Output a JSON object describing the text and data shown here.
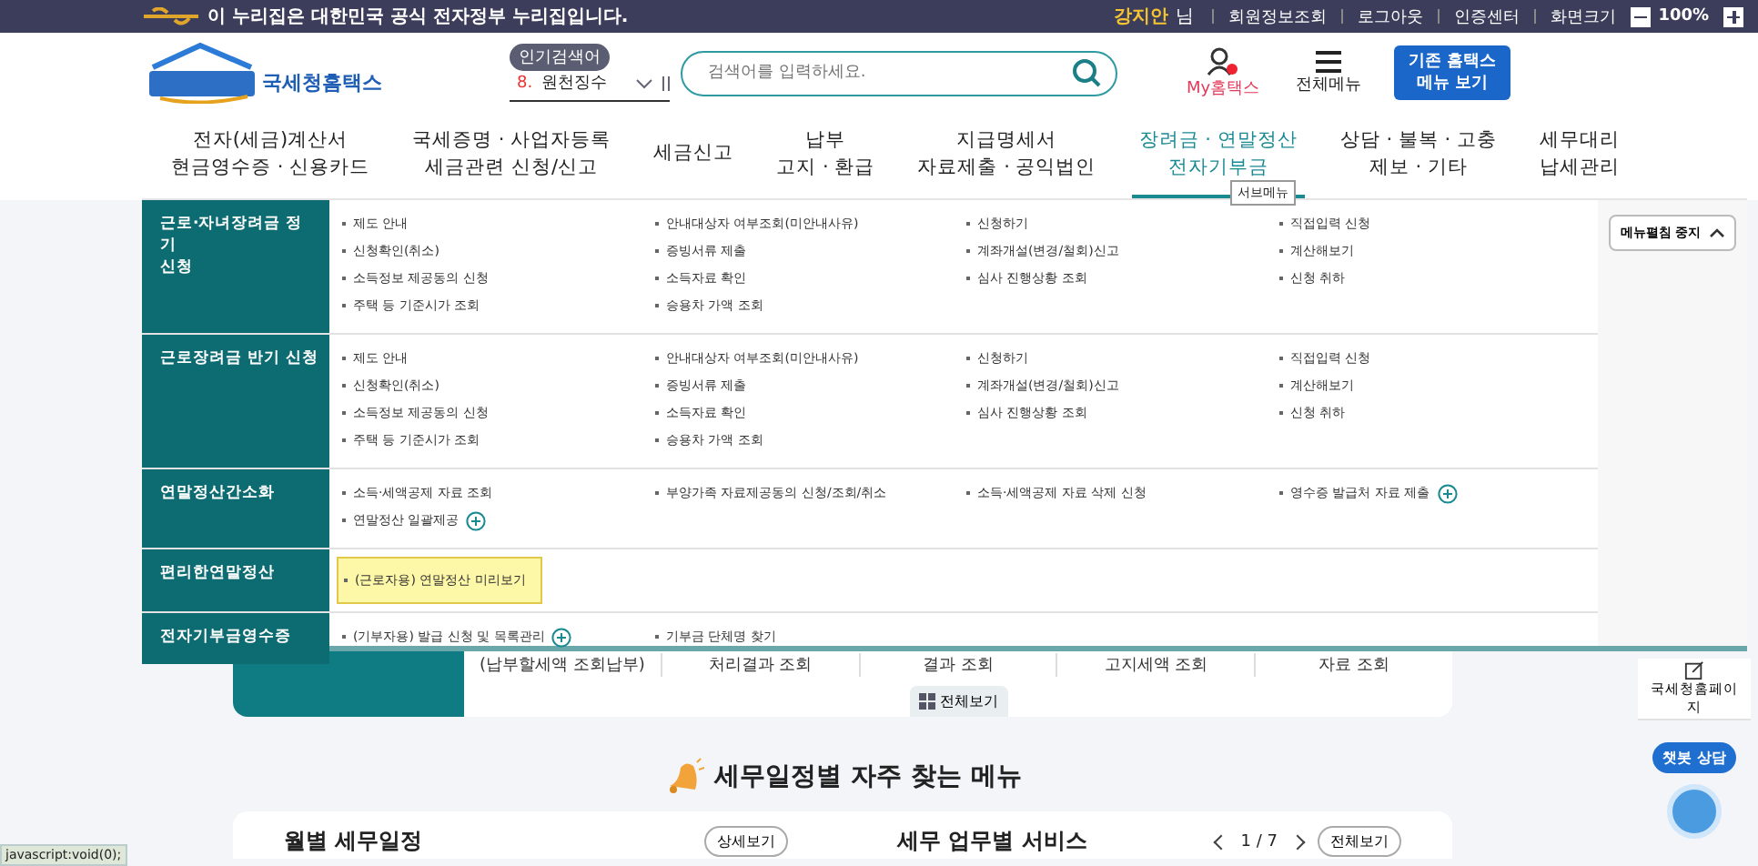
{
  "notice_bar": {
    "text": "이 누리집은 대한민국 공식 전자정부 누리집입니다.",
    "user_name": "강지안",
    "user_suffix": "님",
    "links": [
      "회원정보조회",
      "로그아웃",
      "인증센터",
      "화면크기"
    ],
    "zoom": "100%"
  },
  "header": {
    "logo_text": "국세청홈택스",
    "popular_badge": "인기검색어",
    "popular_rank": "8.",
    "popular_term": "원천징수",
    "search": {
      "placeholder": "검색어를 입력하세요."
    },
    "my_link": "My홈택스",
    "all_menu": "전체메뉴",
    "legacy_button": "기존 홈택스\n메뉴 보기"
  },
  "nav": [
    {
      "label": "전자(세금)계산서\n현금영수증 · 신용카드",
      "selected": false
    },
    {
      "label": "국세증명 · 사업자등록\n세금관련 신청/신고",
      "selected": false
    },
    {
      "label": "세금신고",
      "selected": false
    },
    {
      "label": "납부\n고지 · 환급",
      "selected": false
    },
    {
      "label": "지급명세서\n자료제출 · 공익법인",
      "selected": false
    },
    {
      "label": "장려금 · 연말정산\n전자기부금",
      "selected": true
    },
    {
      "label": "상담 · 불복 · 고충\n제보 · 기타",
      "selected": false
    },
    {
      "label": "세무대리\n납세관리",
      "selected": false
    }
  ],
  "tooltip": "서브메뉴",
  "submenu": {
    "sections": [
      {
        "title": "근로·자녀장려금 정기\n신청",
        "items": [
          {
            "label": "제도 안내"
          },
          {
            "label": "안내대상자 여부조회(미안내사유)"
          },
          {
            "label": "신청하기"
          },
          {
            "label": "직접입력 신청"
          },
          {
            "label": "신청확인(취소)"
          },
          {
            "label": "증빙서류 제출"
          },
          {
            "label": "계좌개설(변경/철회)신고"
          },
          {
            "label": "계산해보기"
          },
          {
            "label": "소득정보 제공동의 신청"
          },
          {
            "label": "소득자료 확인"
          },
          {
            "label": "심사 진행상황 조회"
          },
          {
            "label": "신청 취하"
          },
          {
            "label": "주택 등 기준시가 조회"
          },
          {
            "label": "승용차 가액 조회"
          }
        ]
      },
      {
        "title": "근로장려금 반기 신청",
        "items": [
          {
            "label": "제도 안내"
          },
          {
            "label": "안내대상자 여부조회(미안내사유)"
          },
          {
            "label": "신청하기"
          },
          {
            "label": "직접입력 신청"
          },
          {
            "label": "신청확인(취소)"
          },
          {
            "label": "증빙서류 제출"
          },
          {
            "label": "계좌개설(변경/철회)신고"
          },
          {
            "label": "계산해보기"
          },
          {
            "label": "소득정보 제공동의 신청"
          },
          {
            "label": "소득자료 확인"
          },
          {
            "label": "심사 진행상황 조회"
          },
          {
            "label": "신청 취하"
          },
          {
            "label": "주택 등 기준시가 조회"
          },
          {
            "label": "승용차 가액 조회"
          }
        ]
      },
      {
        "title": "연말정산간소화",
        "items": [
          {
            "label": "소득·세액공제 자료 조회"
          },
          {
            "label": "부양가족 자료제공동의 신청/조회/취소"
          },
          {
            "label": "소득·세액공제 자료 삭제 신청"
          },
          {
            "label": "영수증 발급처 자료 제출",
            "expandable": true
          },
          {
            "label": "연말정산 일괄제공",
            "expandable": true
          }
        ]
      },
      {
        "title": "편리한연말정산",
        "items": [
          {
            "label": "(근로자용) 연말정산 미리보기",
            "highlighted": true
          }
        ]
      },
      {
        "title": "전자기부금영수증",
        "items": [
          {
            "label": "(기부자용) 발급 신청 및 목록관리",
            "expandable": true
          },
          {
            "label": "기부금 단체명 찾기"
          }
        ]
      }
    ],
    "stop_button": "메뉴펼침 중지"
  },
  "service_card": {
    "links": [
      "(납부할세액 조회납부)",
      "처리결과 조회",
      "결과 조회",
      "고지세액 조회",
      "자료 조회"
    ],
    "view_all": "전체보기"
  },
  "schedule_heading": "세무일정별 자주 찾는 메뉴",
  "monthly_card": {
    "title": "월별 세무일정",
    "detail_button": "상세보기"
  },
  "service_by_task": {
    "title": "세무 업무별 서비스",
    "pager": "1 / 7",
    "view_all": "전체보기"
  },
  "side_buttons": [
    "국세청홈페이지"
  ],
  "chatbot_label": "챗봇 상담",
  "status_text": "javascript:void(0);"
}
